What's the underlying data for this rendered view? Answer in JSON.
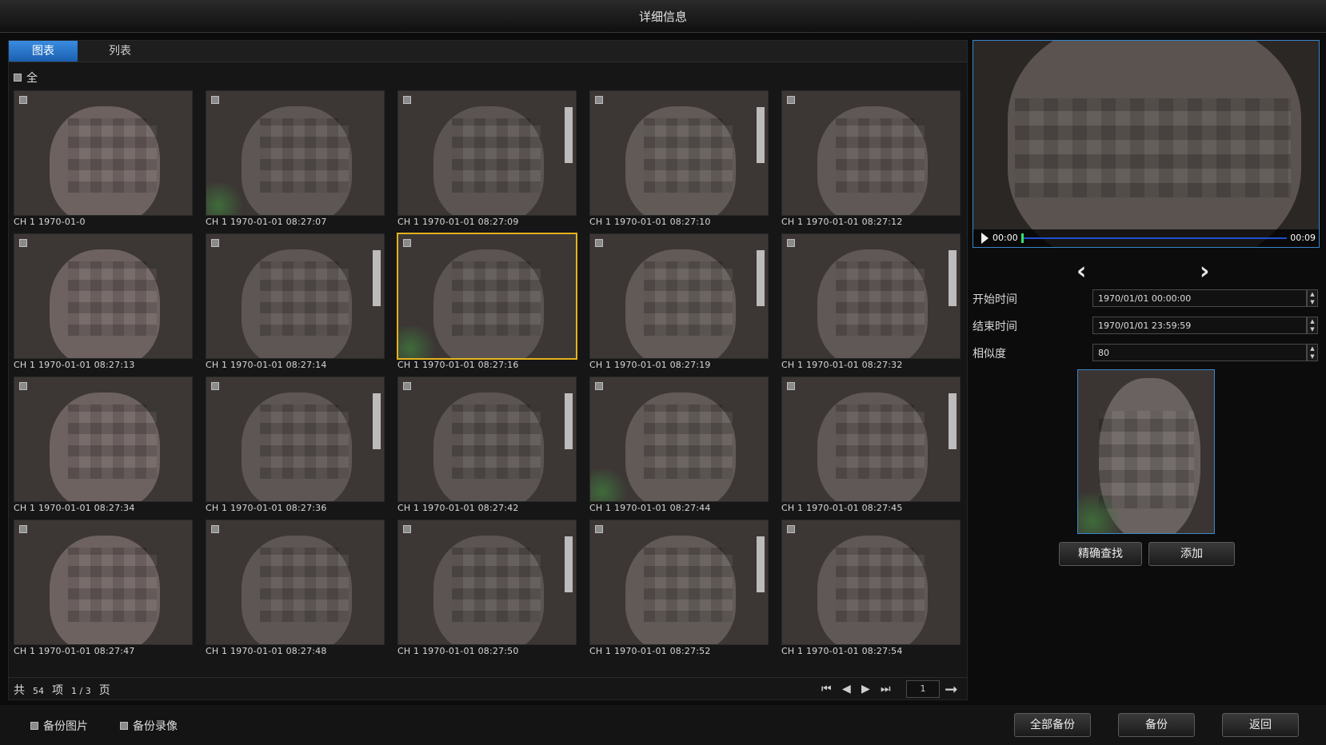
{
  "window": {
    "title": "详细信息"
  },
  "tabs": [
    {
      "label": "图表"
    },
    {
      "label": "列表"
    }
  ],
  "select_all_label": "全",
  "results": [
    "CH 1 1970-01-0",
    "CH 1 1970-01-01 08:27:07",
    "CH 1 1970-01-01 08:27:09",
    "CH 1 1970-01-01 08:27:10",
    "CH 1 1970-01-01 08:27:12",
    "CH 1 1970-01-01 08:27:13",
    "CH 1 1970-01-01 08:27:14",
    "CH 1 1970-01-01 08:27:16",
    "CH 1 1970-01-01 08:27:19",
    "CH 1 1970-01-01 08:27:32",
    "CH 1 1970-01-01 08:27:34",
    "CH 1 1970-01-01 08:27:36",
    "CH 1 1970-01-01 08:27:42",
    "CH 1 1970-01-01 08:27:44",
    "CH 1 1970-01-01 08:27:45",
    "CH 1 1970-01-01 08:27:47",
    "CH 1 1970-01-01 08:27:48",
    "CH 1 1970-01-01 08:27:50",
    "CH 1 1970-01-01 08:27:52",
    "CH 1 1970-01-01 08:27:54"
  ],
  "selected_index": 7,
  "pager": {
    "total_prefix": "共",
    "total": "54",
    "item_unit": "项",
    "page_of": "1 / 3",
    "page_unit": "页",
    "page_input": "1",
    "icons": [
      "first-page-icon",
      "prev-page-icon",
      "next-page-icon",
      "last-page-icon",
      "go-arrow-icon"
    ]
  },
  "video": {
    "time_start": "00:00",
    "time_end": "00:09",
    "progress": 0.0
  },
  "prev_icon": "‹",
  "next_icon": "›",
  "filters": {
    "start_label": "开始时间",
    "start_value": "1970/01/01 00:00:00",
    "end_label": "结束时间",
    "end_value": "1970/01/01 23:59:59",
    "sim_label": "相似度",
    "sim_value": "80"
  },
  "actions": {
    "precise_search": "精确查找",
    "add": "添加"
  },
  "footer": {
    "backup_pictures": "备份图片",
    "backup_video": "备份录像",
    "backup_all": "全部备份",
    "backup": "备份",
    "back": "返回"
  },
  "colors": {
    "accent": "#3a86c8",
    "selection": "#e3b21d",
    "tab_active": "#2a78d0"
  }
}
